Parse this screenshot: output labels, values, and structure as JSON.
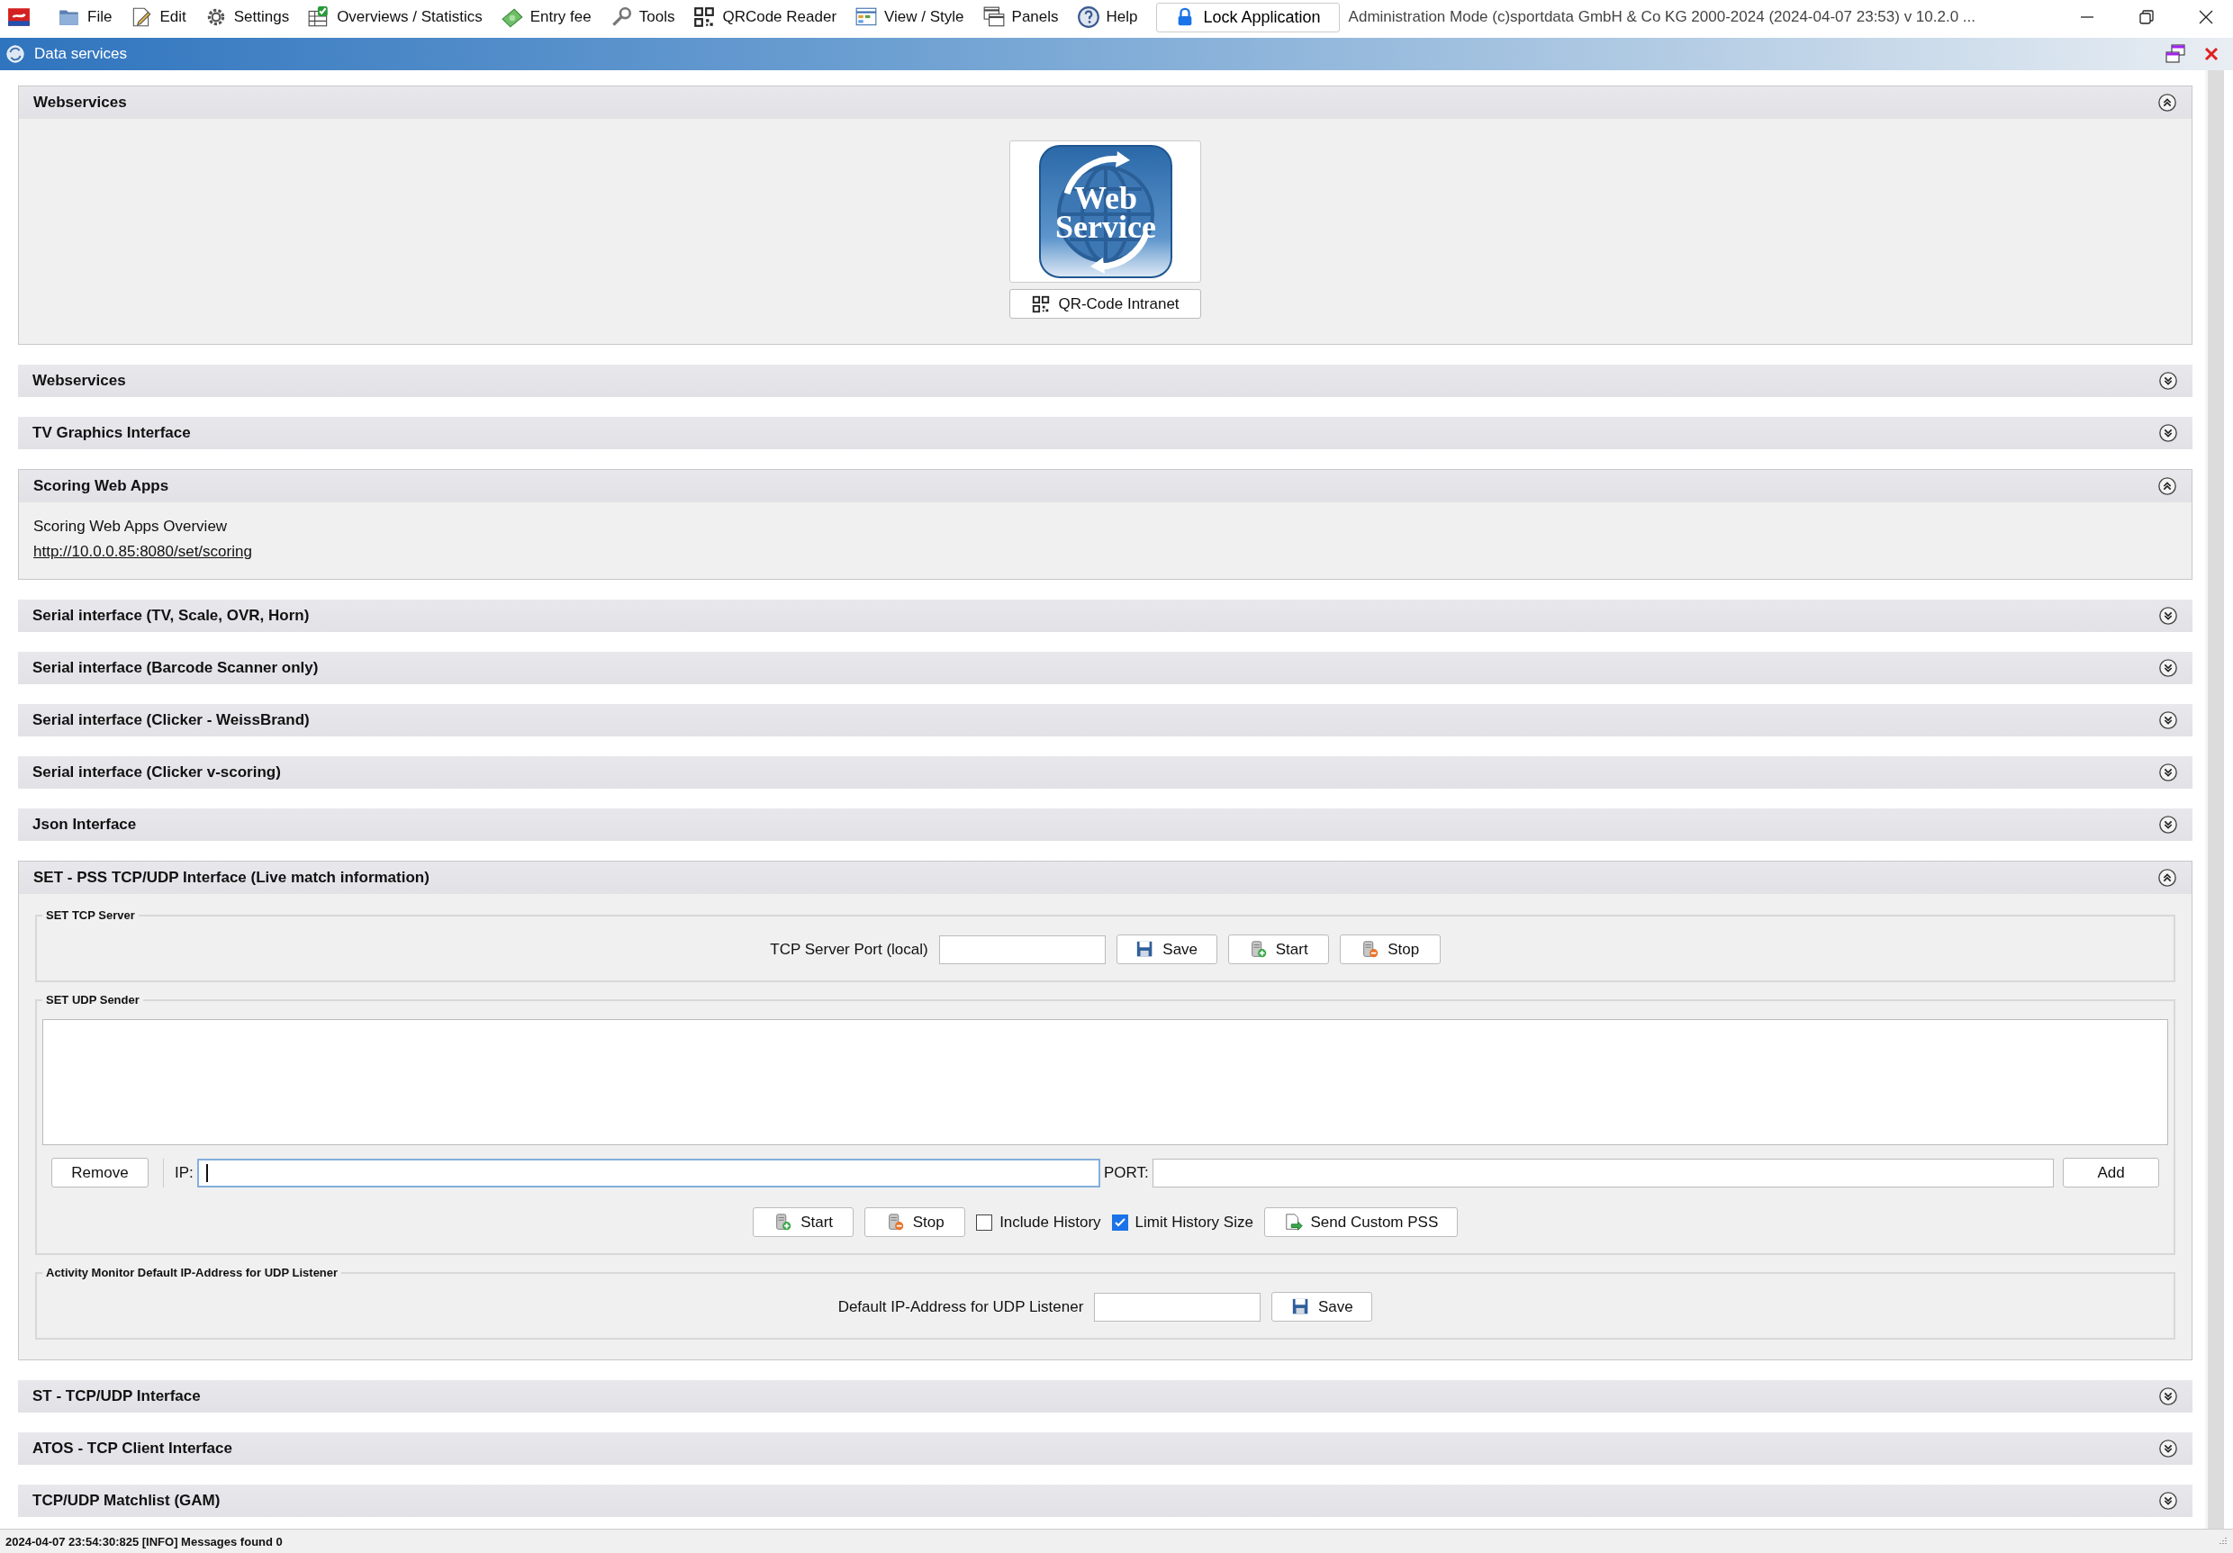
{
  "menu": [
    {
      "label": "File"
    },
    {
      "label": "Edit"
    },
    {
      "label": "Settings"
    },
    {
      "label": "Overviews / Statistics"
    },
    {
      "label": "Entry fee"
    },
    {
      "label": "Tools"
    },
    {
      "label": "QRCode Reader"
    },
    {
      "label": "View / Style"
    },
    {
      "label": "Panels"
    },
    {
      "label": "Help"
    }
  ],
  "lock_button": "Lock Application",
  "app_title": "Administration Mode (c)sportdata GmbH & Co KG 2000-2024 (2024-04-07 23:53)  v 10.2.0 ...",
  "panel": {
    "title": "Data services"
  },
  "sections": [
    {
      "title": "Webservices",
      "expanded": true,
      "kind": "webservice",
      "logo_text": [
        "Web",
        "Service"
      ],
      "button": "QR-Code Intranet"
    },
    {
      "title": "Webservices",
      "expanded": false
    },
    {
      "title": "TV Graphics Interface",
      "expanded": false
    },
    {
      "title": "Scoring Web Apps",
      "expanded": true,
      "kind": "links",
      "label": "Scoring Web Apps Overview",
      "link": "http://10.0.0.85:8080/set/scoring"
    },
    {
      "title": "Serial interface (TV, Scale, OVR, Horn)",
      "expanded": false
    },
    {
      "title": "Serial interface (Barcode Scanner only)",
      "expanded": false
    },
    {
      "title": "Serial interface (Clicker - WeissBrand)",
      "expanded": false
    },
    {
      "title": "Serial interface (Clicker v-scoring)",
      "expanded": false
    },
    {
      "title": "Json Interface",
      "expanded": false
    },
    {
      "title": "SET - PSS TCP/UDP Interface (Live match information)",
      "expanded": true,
      "kind": "set_pss",
      "tcp_server": {
        "legend": "SET TCP Server",
        "port_label": "TCP Server Port (local)",
        "buttons": [
          {
            "label": "Save",
            "kind": "save"
          },
          {
            "label": "Start",
            "kind": "start"
          },
          {
            "label": "Stop",
            "kind": "stop"
          }
        ]
      },
      "udp_sender": {
        "legend": "SET UDP Sender",
        "remove": "Remove",
        "ip_label": "IP:",
        "ip_focused": true,
        "port_label": "PORT:",
        "add": "Add",
        "buttons": [
          {
            "label": "Start",
            "kind": "start"
          },
          {
            "label": "Stop",
            "kind": "stop"
          }
        ],
        "options": [
          {
            "label": "Include History",
            "checked": false
          },
          {
            "label": "Limit History Size",
            "checked": true
          }
        ],
        "send": "Send Custom PSS"
      },
      "activity": {
        "legend": "Activity Monitor Default IP-Address for UDP Listener",
        "label": "Default IP-Address for UDP Listener",
        "buttons": [
          {
            "label": "Save",
            "kind": "save"
          }
        ]
      }
    },
    {
      "title": "ST - TCP/UDP Interface",
      "expanded": false
    },
    {
      "title": "ATOS - TCP Client Interface",
      "expanded": false
    },
    {
      "title": "TCP/UDP Matchlist (GAM)",
      "expanded": false
    }
  ],
  "status_bar": "2024-04-07 23:54:30:825 [INFO] Messages found 0"
}
